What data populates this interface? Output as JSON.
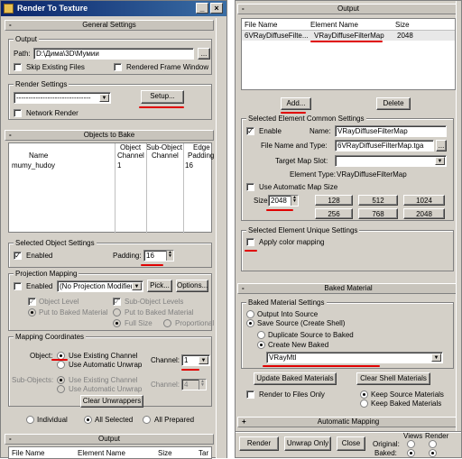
{
  "window": {
    "title": "Render To Texture",
    "close": "×",
    "min": "_"
  },
  "left": {
    "general": {
      "rollout": "General Settings",
      "output_group": "Output",
      "path_label": "Path:",
      "path_value": "D:\\Дима\\3D\\Мумии",
      "browse": "...",
      "skip_existing": "Skip Existing Files",
      "rendered_frame": "Rendered Frame Window",
      "render_settings_group": "Render Settings",
      "preset": "-------------------------------",
      "setup": "Setup...",
      "network": "Network Render"
    },
    "objects": {
      "rollout": "Objects to Bake",
      "col_name": "Name",
      "col_obj1": "Object",
      "col_obj2": "Channel",
      "col_sub1": "Sub-Object",
      "col_sub2": "Channel",
      "col_edge1": "Edge",
      "col_edge2": "Padding",
      "row_name": "mumy_hudoy",
      "row_obj": "1",
      "row_edge": "16"
    },
    "selected": {
      "group": "Selected Object Settings",
      "enabled": "Enabled",
      "padding_label": "Padding:",
      "padding": "16"
    },
    "projection": {
      "group": "Projection Mapping",
      "enabled": "Enabled",
      "modifier": "(No Projection Modifier)",
      "pick": "Pick...",
      "options": "Options...",
      "object_level": "Object Level",
      "sub_levels": "Sub-Object Levels",
      "put_baked": "Put to Baked Material",
      "put_baked2": "Put to Baked Material",
      "full_size": "Full Size",
      "proportional": "Proportional"
    },
    "mapping": {
      "group": "Mapping Coordinates",
      "object_label": "Object:",
      "use_existing": "Use Existing Channel",
      "use_auto": "Use Automatic Unwrap",
      "channel_label": "Channel:",
      "channel": "1",
      "sub_label": "Sub-Objects:",
      "sub_existing": "Use Existing Channel",
      "sub_auto": "Use Automatic Unwrap",
      "sub_channel_label": "Channel:",
      "sub_channel": "4",
      "clear": "Clear Unwrappers"
    },
    "scope": {
      "individual": "Individual",
      "all_selected": "All Selected",
      "all_prepared": "All Prepared"
    },
    "output": {
      "rollout": "Output",
      "col_file": "File Name",
      "col_elem": "Element Name",
      "col_size": "Size",
      "col_tar": "Tar"
    }
  },
  "right": {
    "output": {
      "rollout": "Output",
      "col_file": "File Name",
      "col_elem": "Element Name",
      "col_size": "Size",
      "row_file": "6VRayDiffuseFilte...",
      "row_elem": "VRayDiffuseFilterMap",
      "row_size": "2048",
      "add": "Add...",
      "delete": "Delete"
    },
    "common": {
      "group": "Selected Element Common Settings",
      "enable": "Enable",
      "name_label": "Name:",
      "name": "VRayDiffuseFilterMap",
      "file_label": "File Name and Type:",
      "file": "6VRayDiffuseFilterMap.tga",
      "browse": "...",
      "target_label": "Target Map Slot:",
      "target": "",
      "elem_type_label": "Element Type:",
      "elem_type": "VRayDiffuseFilterMap",
      "auto_size": "Use Automatic Map Size",
      "size_label": "Size:",
      "size": "2048",
      "sizes": [
        "128",
        "512",
        "1024",
        "256",
        "768",
        "2048"
      ]
    },
    "unique": {
      "group": "Selected Element Unique Settings",
      "apply_color": "Apply color mapping"
    },
    "baked": {
      "rollout": "Baked Material",
      "group": "Baked Material Settings",
      "output_into": "Output Into Source",
      "save_source": "Save Source (Create Shell)",
      "duplicate": "Duplicate Source to Baked",
      "create_new": "Create New Baked",
      "material": "VRayMtl",
      "update": "Update Baked Materials",
      "clear_shell": "Clear Shell Materials",
      "render_files": "Render to Files Only",
      "keep_source": "Keep Source Materials",
      "keep_baked": "Keep Baked Materials"
    },
    "auto": {
      "rollout": "Automatic Mapping"
    },
    "bottom": {
      "render": "Render",
      "unwrap_only": "Unwrap Only",
      "close": "Close",
      "original": "Original:",
      "baked": "Baked:",
      "views": "Views",
      "render_col": "Render"
    }
  }
}
